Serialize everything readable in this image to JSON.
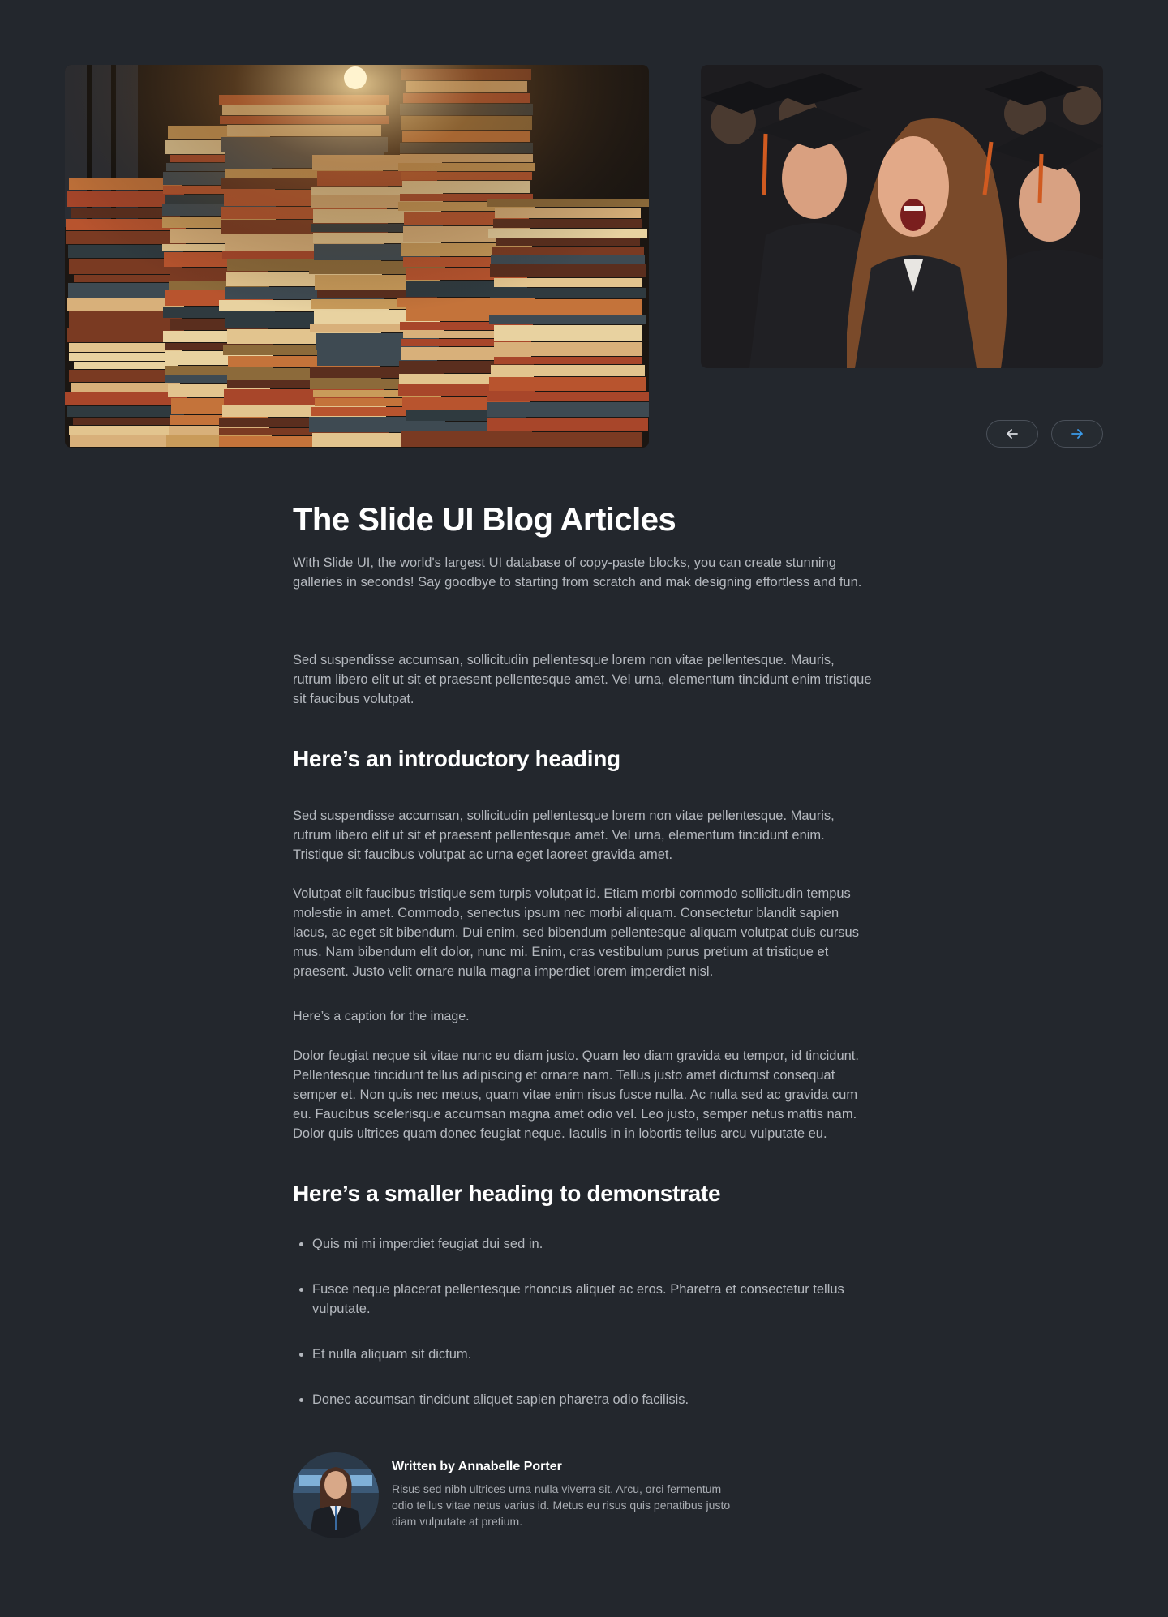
{
  "gallery": {
    "images": [
      {
        "alt": "Stacks of old books"
      },
      {
        "alt": "Graduates celebrating"
      }
    ],
    "prev_icon": "arrow-left-icon",
    "next_icon": "arrow-right-icon",
    "accent_color": "#3b9ae8"
  },
  "article": {
    "title": "The Slide UI Blog Articles",
    "lead": "With Slide UI, the world's largest UI database of copy-paste blocks, you can create stunning galleries in seconds! Say goodbye to starting from scratch and mak designing effortless and fun.",
    "p1": "Sed suspendisse accumsan, sollicitudin pellentesque lorem non vitae pellentesque. Mauris, rutrum libero elit ut sit et praesent pellentesque amet. Vel urna, elementum tincidunt enim tristique sit faucibus volutpat.",
    "heading_intro": "Here’s an introductory heading",
    "p2": "Sed suspendisse accumsan, sollicitudin pellentesque lorem non vitae pellentesque. Mauris, rutrum libero elit ut sit et praesent pellentesque amet. Vel urna, elementum tincidunt enim. Tristique sit faucibus volutpat ac urna eget laoreet gravida amet.",
    "p3": "Volutpat elit faucibus tristique sem turpis volutpat id. Etiam morbi commodo sollicitudin tempus molestie in amet. Commodo, senectus ipsum nec morbi aliquam. Consectetur blandit sapien lacus, ac eget sit bibendum. Dui enim, sed bibendum pellentesque aliquam volutpat duis cursus mus. Nam bibendum elit dolor, nunc mi. Enim, cras vestibulum purus pretium at tristique et praesent. Justo velit ornare nulla magna imperdiet lorem imperdiet nisl.",
    "caption": "Here’s a caption for the image.",
    "p4": "Dolor feugiat neque sit vitae nunc eu diam justo. Quam leo diam gravida eu tempor, id tincidunt. Pellentesque tincidunt tellus adipiscing et ornare nam. Tellus justo amet dictumst consequat semper et. Non quis nec metus, quam vitae enim risus fusce nulla. Ac nulla sed ac gravida cum eu. Faucibus scelerisque accumsan magna amet odio vel. Leo justo, semper netus mattis nam. Dolor quis ultrices quam donec feugiat neque. Iaculis in in lobortis tellus arcu vulputate eu.",
    "heading_small": "Here’s a smaller heading to demonstrate",
    "bullets": [
      "Quis mi mi imperdiet feugiat dui sed in.",
      "Fusce neque placerat pellentesque rhoncus aliquet ac eros. Pharetra et consectetur tellus vulputate.",
      "Et nulla aliquam sit dictum.",
      "Donec accumsan tincidunt aliquet sapien pharetra odio facilisis."
    ]
  },
  "author": {
    "name": "Written by Annabelle Porter",
    "bio": "Risus sed nibh ultrices urna nulla viverra sit. Arcu, orci fermentum odio tellus vitae netus varius id. Metus eu risus quis penatibus justo diam vulputate at pretium."
  }
}
